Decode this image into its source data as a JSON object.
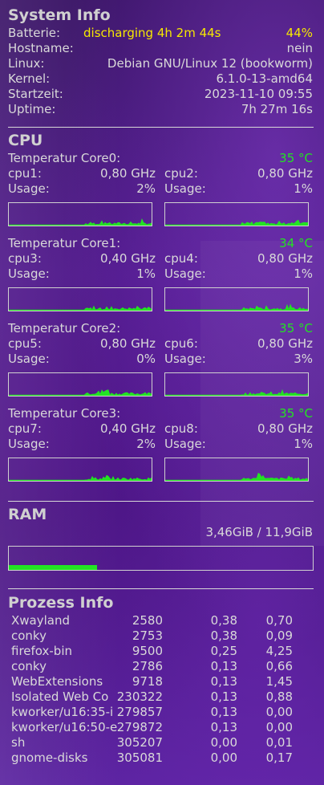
{
  "system": {
    "title": "System Info",
    "rows": [
      {
        "label": "Batterie:",
        "extra": "discharging 4h 2m 44s",
        "value": "44%"
      },
      {
        "label": "Hostname:",
        "value": "nein"
      },
      {
        "label": "Linux:",
        "value": "Debian GNU/Linux 12 (bookworm)"
      },
      {
        "label": "Kernel:",
        "value": "6.1.0-13-amd64"
      },
      {
        "label": "Startzeit:",
        "value": "2023-11-10 09:55"
      },
      {
        "label": "Uptime:",
        "value": "7h 27m 16s"
      }
    ]
  },
  "cpu": {
    "title": "CPU",
    "usage_label": "Usage:",
    "cores": [
      {
        "temp_label": "Temperatur Core0:",
        "temp": "35 °C",
        "cpus": [
          {
            "name": "cpu1:",
            "freq": "0,80 GHz",
            "usage": "2%"
          },
          {
            "name": "cpu2:",
            "freq": "0,80 GHz",
            "usage": "1%"
          }
        ]
      },
      {
        "temp_label": "Temperatur Core1:",
        "temp": "34 °C",
        "cpus": [
          {
            "name": "cpu3:",
            "freq": "0,40 GHz",
            "usage": "1%"
          },
          {
            "name": "cpu4:",
            "freq": "0,80 GHz",
            "usage": "1%"
          }
        ]
      },
      {
        "temp_label": "Temperatur Core2:",
        "temp": "35 °C",
        "cpus": [
          {
            "name": "cpu5:",
            "freq": "0,80 GHz",
            "usage": "0%"
          },
          {
            "name": "cpu6:",
            "freq": "0,80 GHz",
            "usage": "3%"
          }
        ]
      },
      {
        "temp_label": "Temperatur Core3:",
        "temp": "35 °C",
        "cpus": [
          {
            "name": "cpu7:",
            "freq": "0,40 GHz",
            "usage": "2%"
          },
          {
            "name": "cpu8:",
            "freq": "0,80 GHz",
            "usage": "1%"
          }
        ]
      }
    ]
  },
  "ram": {
    "title": "RAM",
    "usage": "3,46GiB / 11,9GiB",
    "used_fraction": 0.29
  },
  "processes": {
    "title": "Prozess Info",
    "rows": [
      {
        "name": "Xwayland",
        "pid": "2580",
        "cpu": "0,38",
        "mem": "0,70"
      },
      {
        "name": "conky",
        "pid": "2753",
        "cpu": "0,38",
        "mem": "0,09"
      },
      {
        "name": "firefox-bin",
        "pid": "9500",
        "cpu": "0,25",
        "mem": "4,25"
      },
      {
        "name": "conky",
        "pid": "2786",
        "cpu": "0,13",
        "mem": "0,66"
      },
      {
        "name": "WebExtensions",
        "pid": "9718",
        "cpu": "0,13",
        "mem": "1,45"
      },
      {
        "name": "Isolated Web Co",
        "pid": "230322",
        "cpu": "0,13",
        "mem": "0,88"
      },
      {
        "name": "kworker/u16:35-i",
        "pid": "279857",
        "cpu": "0,13",
        "mem": "0,00"
      },
      {
        "name": "kworker/u16:50-e",
        "pid": "279872",
        "cpu": "0,13",
        "mem": "0,00"
      },
      {
        "name": "sh",
        "pid": "305207",
        "cpu": "0,00",
        "mem": "0,01"
      },
      {
        "name": "gnome-disks",
        "pid": "305081",
        "cpu": "0,00",
        "mem": "0,17"
      }
    ]
  },
  "colors": {
    "accent_green": "#23e323",
    "accent_yellow": "#f6e800",
    "text": "#d9d9d9"
  }
}
